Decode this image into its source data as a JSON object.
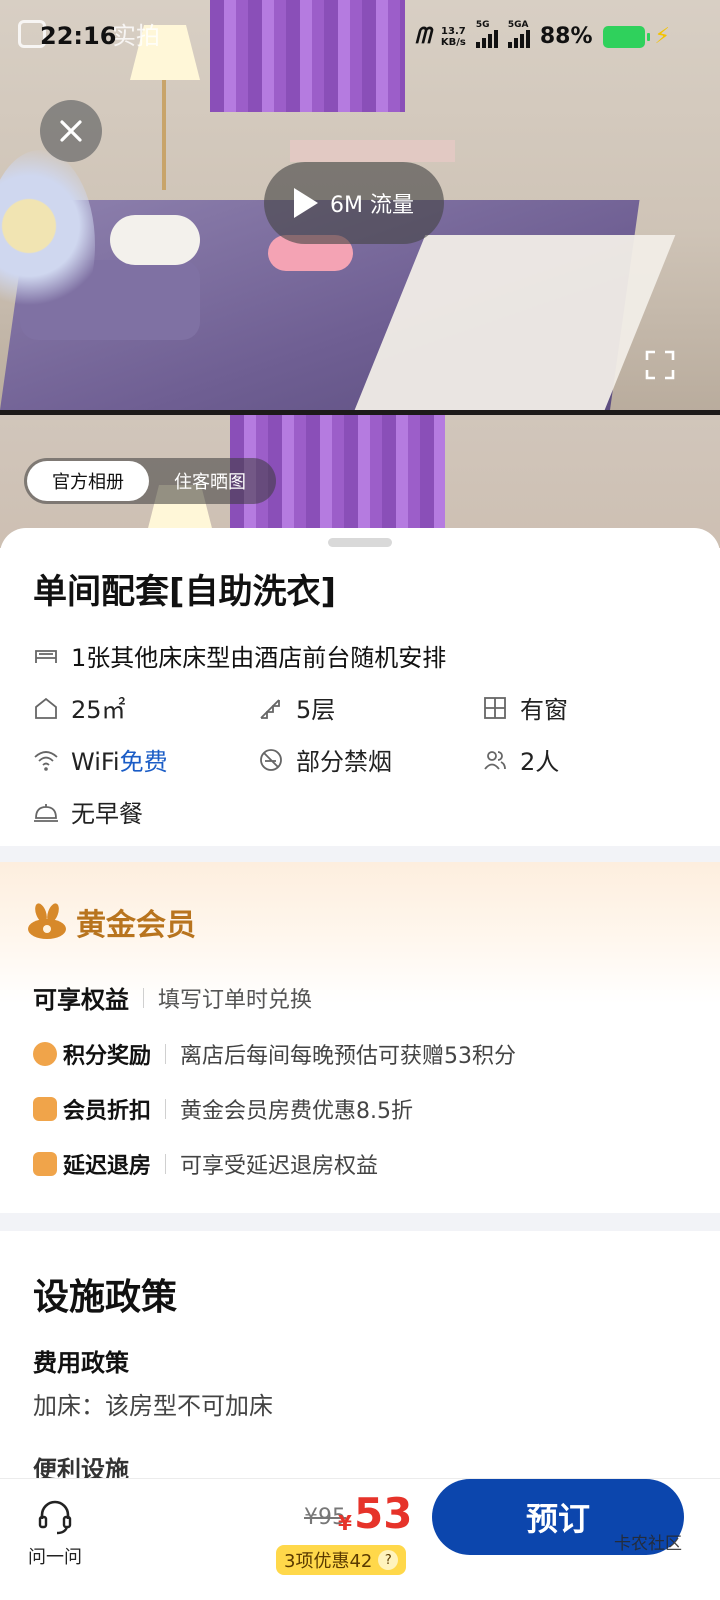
{
  "status_bar": {
    "time": "22:16",
    "ghost_banner": "实拍",
    "net_speed_value": "13.7",
    "net_speed_unit": "KB/s",
    "sim1": "5G",
    "sim2": "5GA",
    "battery": "88%"
  },
  "gallery": {
    "play_label": "6M 流量",
    "tabs": [
      {
        "label": "官方相册",
        "active": true
      },
      {
        "label": "住客晒图",
        "active": false
      }
    ]
  },
  "room": {
    "title": "单间配套[自助洗衣]",
    "bed": "1张其他床床型由酒店前台随机安排",
    "area": "25㎡",
    "floor": "5层",
    "window": "有窗",
    "wifi_label": "WiFi",
    "wifi_free": "免费",
    "smoking": "部分禁烟",
    "occupancy": "2人",
    "breakfast": "无早餐"
  },
  "member": {
    "level": "黄金会员",
    "benefits_title": "可享权益",
    "benefits_note": "填写订单时兑换",
    "benefits": [
      {
        "name": "积分奖励",
        "desc": "离店后每间每晚预估可获赠53积分",
        "icon": "coins-icon"
      },
      {
        "name": "会员折扣",
        "desc": "黄金会员房费优惠8.5折",
        "icon": "discount-icon"
      },
      {
        "name": "延迟退房",
        "desc": "可享受延迟退房权益",
        "icon": "late-checkout-icon"
      }
    ]
  },
  "policy": {
    "title": "设施政策",
    "fee_title": "费用政策",
    "extra_bed": "加床：该房型不可加床",
    "next_section_partial": "便利设施"
  },
  "bottom_bar": {
    "ask_label": "问一问",
    "original_price": "¥95",
    "currency": "¥",
    "current_price": "53",
    "discount_text": "3项优惠42",
    "book_label": "预订",
    "watermark": "卡农社区"
  },
  "colors": {
    "accent_blue": "#0c46ad",
    "price_red": "#e6332a",
    "gold": "#b8741e",
    "discount_yellow": "#ffd84a"
  }
}
